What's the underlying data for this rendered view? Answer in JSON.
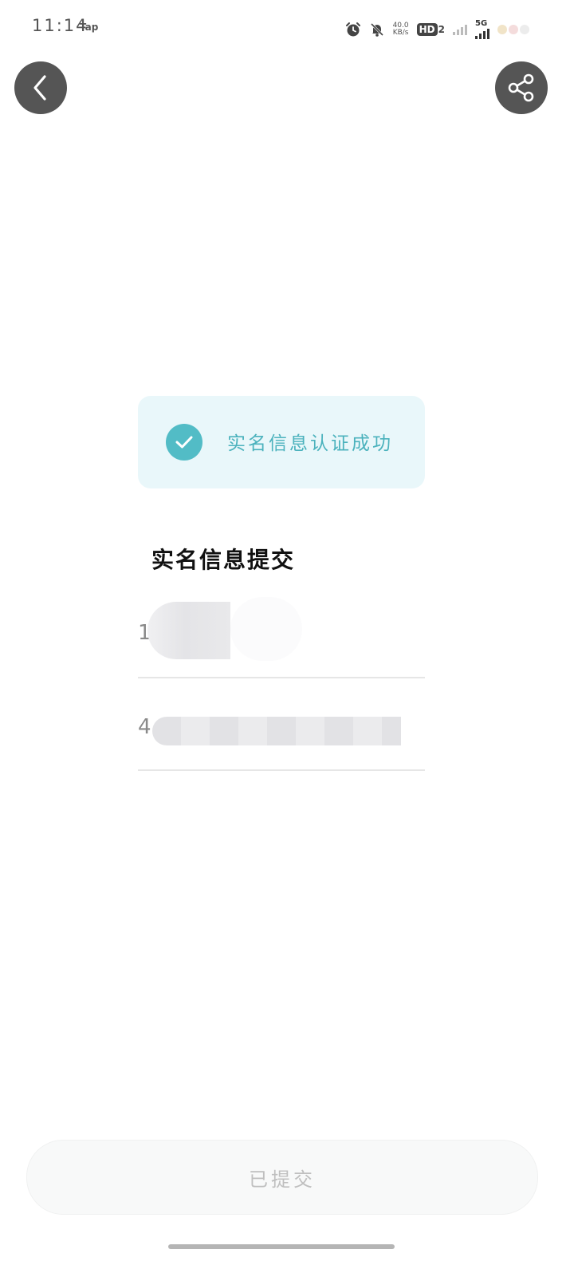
{
  "status_bar": {
    "time": "11:14",
    "app_label": "Tap",
    "net_speed_value": "40.0",
    "net_speed_unit": "KB/s",
    "hd_label": "HD",
    "hd_sub": "2",
    "network_type": "5G"
  },
  "nav": {
    "back_icon": "chevron-left-icon",
    "share_icon": "share-icon"
  },
  "success_banner": {
    "text": "实名信息认证成功",
    "bg_color": "#e9f7fa",
    "accent_color": "#52bcc6"
  },
  "section": {
    "title": "实名信息提交"
  },
  "fields": {
    "name_prefix": "1",
    "id_prefix": "4"
  },
  "submit": {
    "label": "已提交"
  }
}
